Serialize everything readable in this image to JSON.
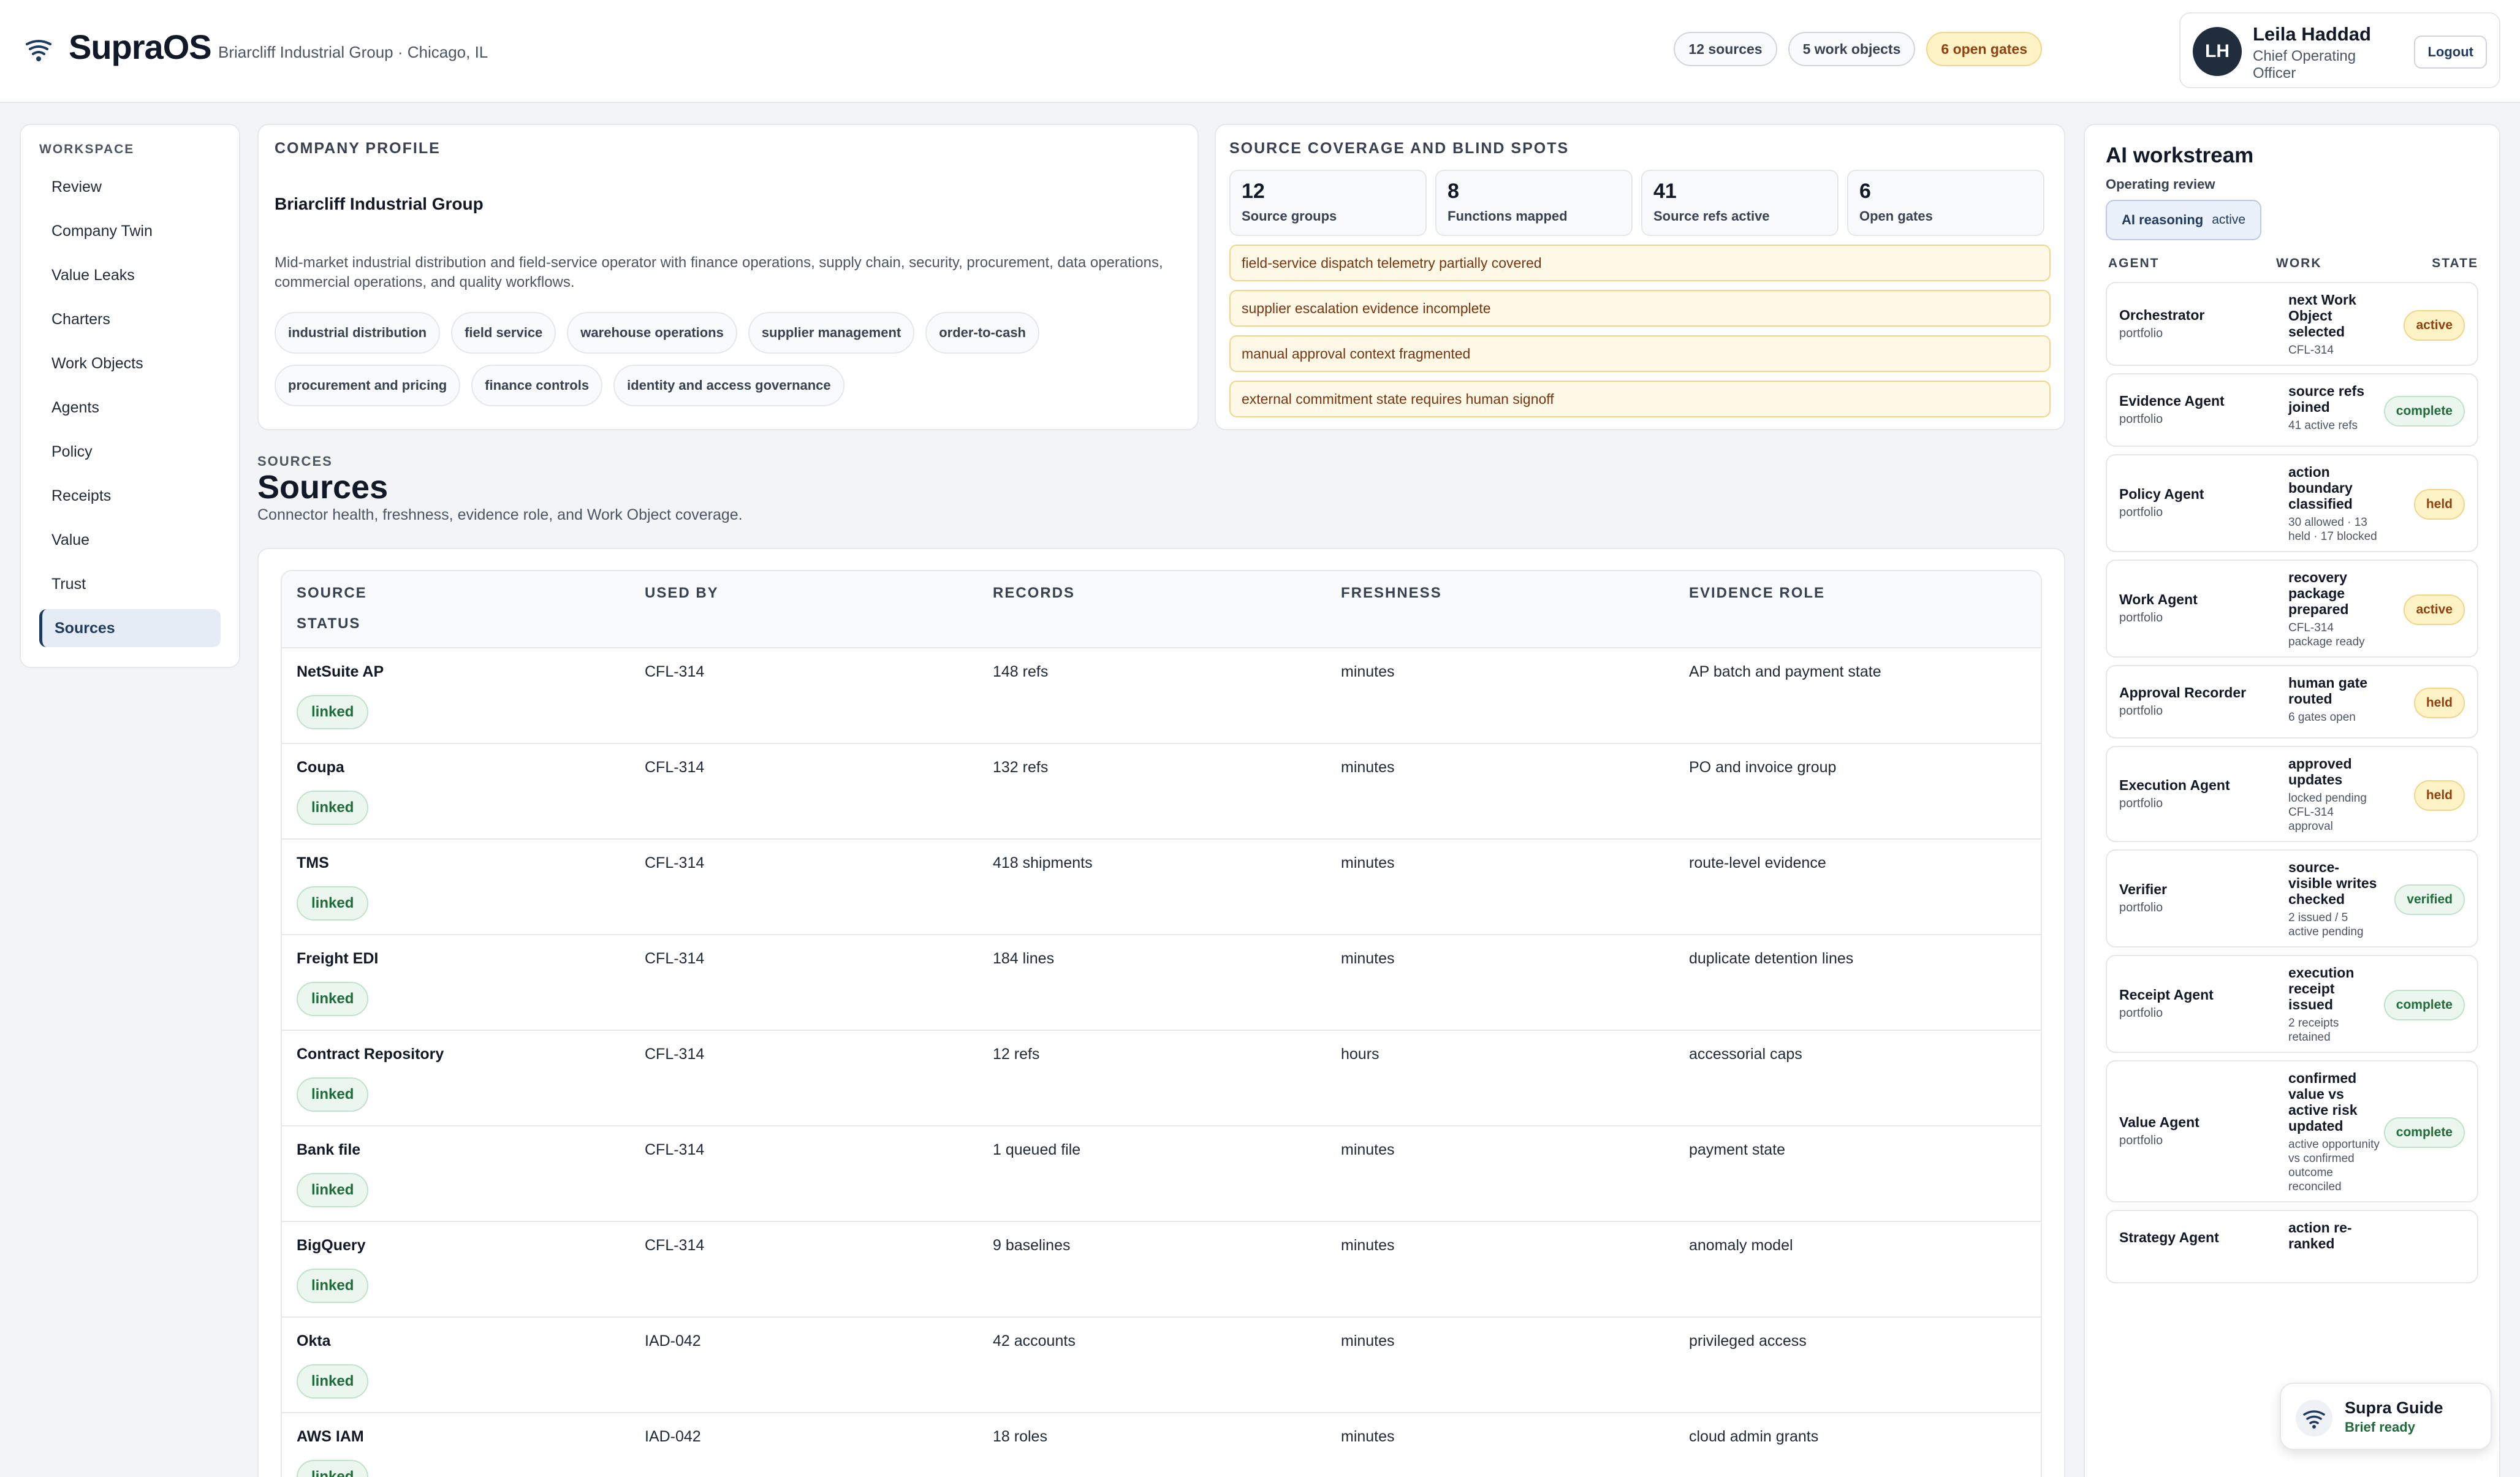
{
  "header": {
    "brand": "SupraOS",
    "org": "Briarcliff Industrial Group · Chicago, IL",
    "pills": [
      "12 sources",
      "5 work objects",
      "6 open gates"
    ],
    "user": {
      "initials": "LH",
      "name": "Leila Haddad",
      "role": "Chief Operating Officer",
      "logout": "Logout"
    }
  },
  "sidebar": {
    "heading": "WORKSPACE",
    "items": [
      "Review",
      "Company Twin",
      "Value Leaks",
      "Charters",
      "Work Objects",
      "Agents",
      "Policy",
      "Receipts",
      "Value",
      "Trust",
      "Sources"
    ],
    "active": "Sources"
  },
  "profile": {
    "label": "COMPANY PROFILE",
    "name": "Briarcliff Industrial Group",
    "description": "Mid-market industrial distribution and field-service operator with finance operations, supply chain, security, procurement, data operations, commercial operations, and quality workflows.",
    "tags": [
      "industrial distribution",
      "field service",
      "warehouse operations",
      "supplier management",
      "order-to-cash",
      "procurement and pricing",
      "finance controls",
      "identity and access governance"
    ]
  },
  "coverage": {
    "label": "SOURCE COVERAGE AND BLIND SPOTS",
    "stats": [
      {
        "num": "12",
        "label": "Source groups"
      },
      {
        "num": "8",
        "label": "Functions mapped"
      },
      {
        "num": "41",
        "label": "Source refs active"
      },
      {
        "num": "6",
        "label": "Open gates"
      }
    ],
    "blind_spots": [
      "field-service dispatch telemetry partially covered",
      "supplier escalation evidence incomplete",
      "manual approval context fragmented",
      "external commitment state requires human signoff"
    ]
  },
  "sources": {
    "eyebrow": "SOURCES",
    "title": "Sources",
    "subtitle": "Connector health, freshness, evidence role, and Work Object coverage.",
    "columns": [
      "SOURCE",
      "USED BY",
      "RECORDS",
      "FRESHNESS",
      "EVIDENCE ROLE",
      "STATUS"
    ],
    "rows": [
      {
        "source": "NetSuite AP",
        "used_by": "CFL-314",
        "records": "148 refs",
        "freshness": "minutes",
        "role": "AP batch and payment state",
        "status": "linked"
      },
      {
        "source": "Coupa",
        "used_by": "CFL-314",
        "records": "132 refs",
        "freshness": "minutes",
        "role": "PO and invoice group",
        "status": "linked"
      },
      {
        "source": "TMS",
        "used_by": "CFL-314",
        "records": "418 shipments",
        "freshness": "minutes",
        "role": "route-level evidence",
        "status": "linked"
      },
      {
        "source": "Freight EDI",
        "used_by": "CFL-314",
        "records": "184 lines",
        "freshness": "minutes",
        "role": "duplicate detention lines",
        "status": "linked"
      },
      {
        "source": "Contract Repository",
        "used_by": "CFL-314",
        "records": "12 refs",
        "freshness": "hours",
        "role": "accessorial caps",
        "status": "linked"
      },
      {
        "source": "Bank file",
        "used_by": "CFL-314",
        "records": "1 queued file",
        "freshness": "minutes",
        "role": "payment state",
        "status": "linked"
      },
      {
        "source": "BigQuery",
        "used_by": "CFL-314",
        "records": "9 baselines",
        "freshness": "minutes",
        "role": "anomaly model",
        "status": "linked"
      },
      {
        "source": "Okta",
        "used_by": "IAD-042",
        "records": "42 accounts",
        "freshness": "minutes",
        "role": "privileged access",
        "status": "linked"
      },
      {
        "source": "AWS IAM",
        "used_by": "IAD-042",
        "records": "18 roles",
        "freshness": "minutes",
        "role": "cloud admin grants",
        "status": "linked"
      }
    ]
  },
  "workstream": {
    "title": "AI workstream",
    "subtitle": "Operating review",
    "reasoning_label": "AI reasoning",
    "reasoning_state": "active",
    "columns": [
      "AGENT",
      "WORK",
      "STATE"
    ],
    "agents": [
      {
        "name": "Orchestrator",
        "scope": "portfolio",
        "work": "next Work Object selected",
        "detail": "CFL-314",
        "state": "active"
      },
      {
        "name": "Evidence Agent",
        "scope": "portfolio",
        "work": "source refs joined",
        "detail": "41 active refs",
        "state": "complete"
      },
      {
        "name": "Policy Agent",
        "scope": "portfolio",
        "work": "action boundary classified",
        "detail": "30 allowed · 13 held · 17 blocked",
        "state": "held"
      },
      {
        "name": "Work Agent",
        "scope": "portfolio",
        "work": "recovery package prepared",
        "detail": "CFL-314 package ready",
        "state": "active"
      },
      {
        "name": "Approval Recorder",
        "scope": "portfolio",
        "work": "human gate routed",
        "detail": "6 gates open",
        "state": "held"
      },
      {
        "name": "Execution Agent",
        "scope": "portfolio",
        "work": "approved updates",
        "detail": "locked pending CFL-314 approval",
        "state": "held"
      },
      {
        "name": "Verifier",
        "scope": "portfolio",
        "work": "source-visible writes checked",
        "detail": "2 issued / 5 active pending",
        "state": "verified"
      },
      {
        "name": "Receipt Agent",
        "scope": "portfolio",
        "work": "execution receipt issued",
        "detail": "2 receipts retained",
        "state": "complete"
      },
      {
        "name": "Value Agent",
        "scope": "portfolio",
        "work": "confirmed value vs active risk updated",
        "detail": "active opportunity vs confirmed outcome reconciled",
        "state": "complete"
      },
      {
        "name": "Strategy Agent",
        "scope": "",
        "work": "action re-ranked",
        "detail": "",
        "state": ""
      }
    ]
  },
  "guide": {
    "title": "Supra Guide",
    "subtitle": "Brief ready"
  }
}
